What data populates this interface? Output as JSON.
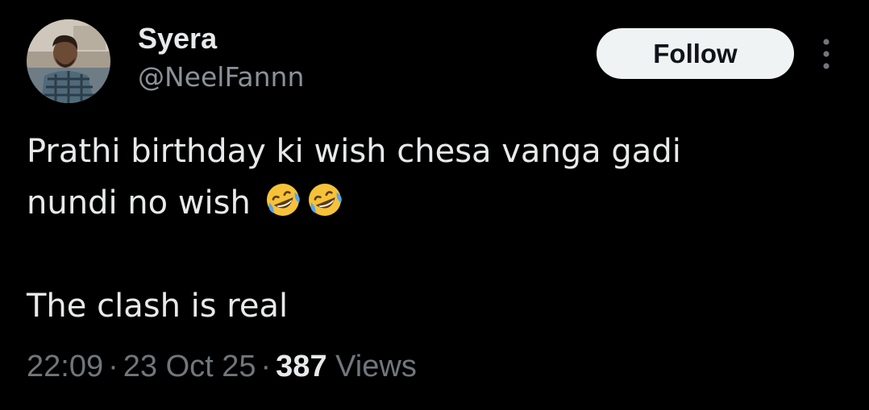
{
  "author": {
    "display_name": "Syera",
    "handle": "@NeelFannn",
    "avatar_icon": "user-photo-avatar"
  },
  "actions": {
    "follow_label": "Follow",
    "more_icon": "vertical-ellipsis-icon"
  },
  "tweet": {
    "line1": "Prathi birthday ki wish chesa vanga gadi",
    "line2": "nundi no wish",
    "line2_emoji": "rolling-on-floor-laughing-emoji",
    "line3": "The clash is real"
  },
  "meta": {
    "time": "22:09",
    "separator": "·",
    "date": "23 Oct 25",
    "views_count": "387",
    "views_label": "Views"
  },
  "colors": {
    "background": "#000000",
    "primary_text": "#e7e9ea",
    "secondary_text": "#71767b",
    "follow_button_bg": "#eff3f4",
    "follow_button_text": "#0f1419"
  }
}
